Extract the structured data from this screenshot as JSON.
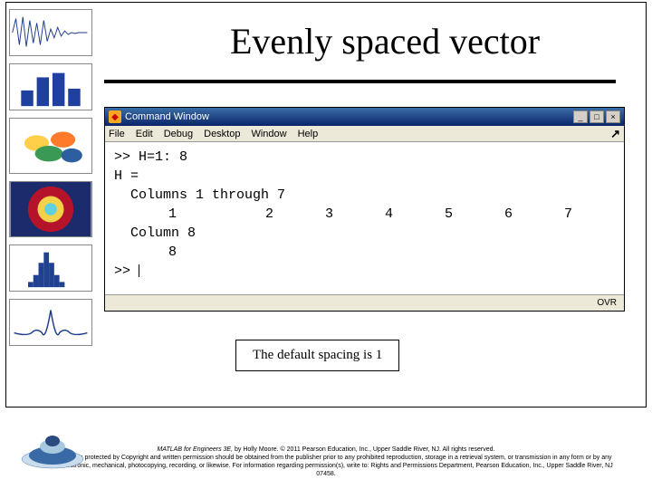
{
  "title": "Evenly spaced vector",
  "window": {
    "title": "Command Window",
    "menu": [
      "File",
      "Edit",
      "Debug",
      "Desktop",
      "Window",
      "Help"
    ],
    "close_hint": "×",
    "lines": {
      "cmd": ">> H=1: 8",
      "varname": "H =",
      "cols_header": "Columns 1 through 7",
      "vals7": [
        "1",
        "2",
        "3",
        "4",
        "5",
        "6",
        "7"
      ],
      "col8_header": "Column 8",
      "val8": "8",
      "prompt": ">>"
    },
    "status": "OVR"
  },
  "caption": "The default spacing is 1",
  "footer": {
    "l1_italic": "MATLAB for Engineers 3E, ",
    "l1_rest": "by Holly Moore. © 2011 Pearson Education, Inc., Upper Saddle River, NJ.  All rights reserved.",
    "l2": "This material is protected by Copyright and written permission should be obtained from the publisher prior to any prohibited reproduction, storage in a retrieval system, or transmission in any form or by any means, electronic, mechanical, photocopying, recording, or likewise. For information regarding permission(s), write to: Rights and Permissions Department, Pearson Education, Inc., Upper Saddle River, NJ 07458."
  }
}
